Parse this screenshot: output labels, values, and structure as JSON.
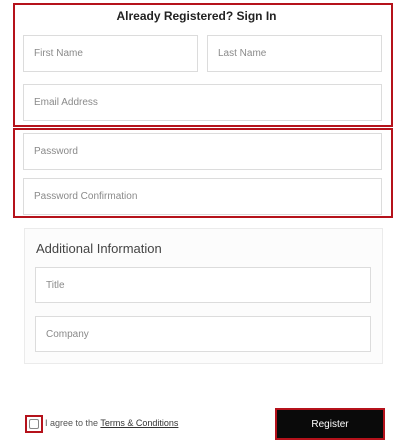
{
  "header": {
    "title_prefix": "Already Registered? ",
    "title_link": "Sign In"
  },
  "form": {
    "first_name": {
      "placeholder": "First Name",
      "value": ""
    },
    "last_name": {
      "placeholder": "Last Name",
      "value": ""
    },
    "email": {
      "placeholder": "Email Address",
      "value": ""
    },
    "password": {
      "placeholder": "Password",
      "value": ""
    },
    "password_confirmation": {
      "placeholder": "Password Confirmation",
      "value": ""
    }
  },
  "additional": {
    "heading": "Additional Information",
    "title": {
      "placeholder": "Title",
      "value": ""
    },
    "company": {
      "placeholder": "Company",
      "value": ""
    }
  },
  "agreement": {
    "prefix": "I agree to the ",
    "link": "Terms & Conditions",
    "checked": false
  },
  "actions": {
    "register_label": "Register"
  },
  "colors": {
    "highlight": "#b5121b",
    "button_bg": "#0a0a0a"
  }
}
